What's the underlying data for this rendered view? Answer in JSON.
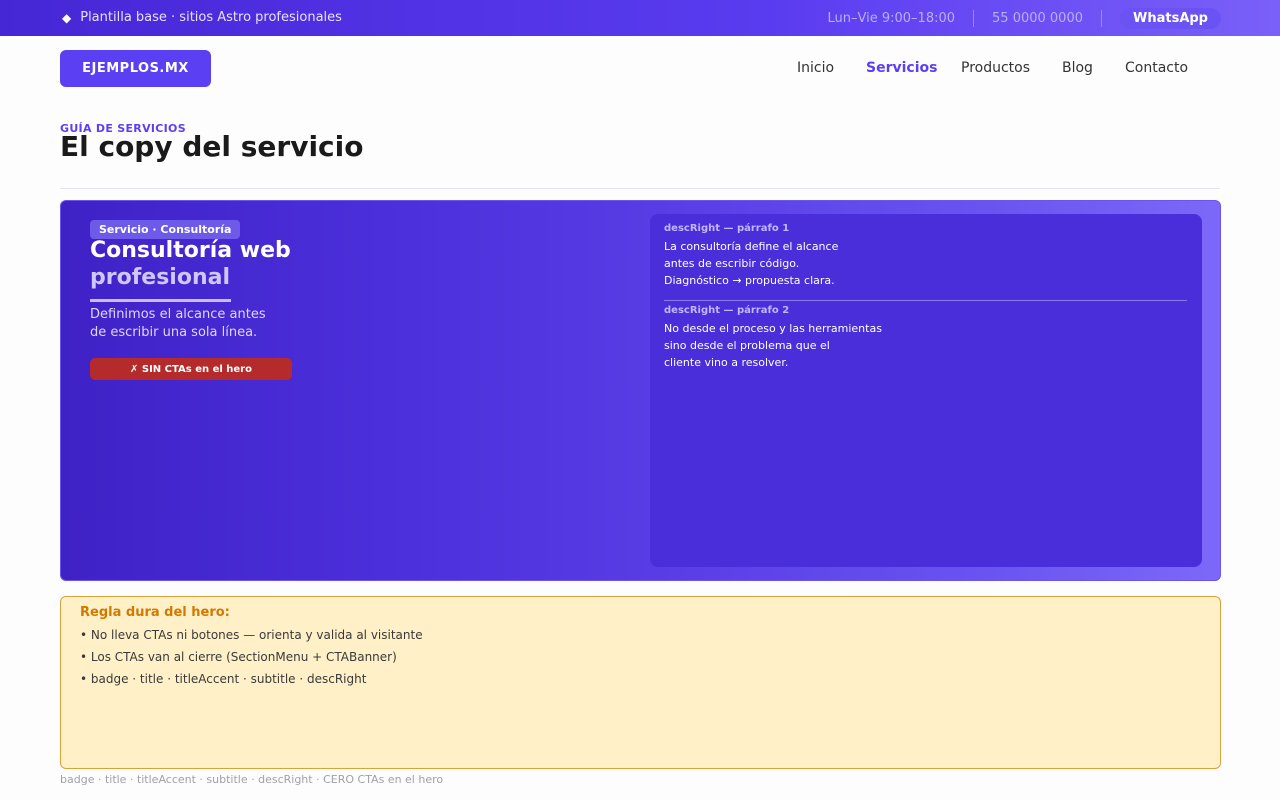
{
  "topbar": {
    "diamond_icon": "diamond-icon",
    "tagline": "Plantilla base · sitios Astro profesionales",
    "hours": "Lun–Vie  9:00–18:00",
    "phone": "55 0000 0000",
    "whatsapp_label": "WhatsApp"
  },
  "navbar": {
    "logo": "EJEMPLOS.MX",
    "items": [
      {
        "label": "Inicio",
        "active": false
      },
      {
        "label": "Servicios",
        "active": true
      },
      {
        "label": "Productos",
        "active": false
      },
      {
        "label": "Blog",
        "active": false
      },
      {
        "label": "Contacto",
        "active": false
      }
    ]
  },
  "header": {
    "eyebrow": "GUÍA DE SERVICIOS",
    "title": "El copy del servicio"
  },
  "hero": {
    "badge": "Servicio · Consultoría",
    "title": "Consultoría web",
    "title_accent": "profesional",
    "subtitle_lines": [
      "Definimos el alcance antes",
      "de escribir una sola línea."
    ],
    "no_cta_label": "✗ SIN CTAs en el hero",
    "desc_right": {
      "p1_label": "descRight — párrafo 1",
      "p1_lines": [
        "La consultoría define el alcance",
        "antes de escribir código.",
        "Diagnóstico → propuesta clara."
      ],
      "p2_label": "descRight — párrafo 2",
      "p2_lines": [
        "No desde el proceso y las herramientas",
        "sino desde el problema que el",
        "cliente vino a resolver."
      ]
    }
  },
  "rule": {
    "title": "Regla dura del hero:",
    "items": [
      "• No lleva CTAs ni botones — orienta y valida al visitante",
      "• Los CTAs van al cierre (SectionMenu + CTABanner)",
      "• badge · title · titleAccent · subtitle · descRight"
    ]
  },
  "footnote": "badge · title · titleAccent · subtitle · descRight · CERO CTAs en el hero",
  "colors": {
    "brand": "#5b3ff3",
    "hero_start": "#3f22c6",
    "hero_end": "#7c68f8",
    "danger": "#b52a2a",
    "warning_bg": "#fff0c7",
    "warning_text": "#d27a00"
  }
}
